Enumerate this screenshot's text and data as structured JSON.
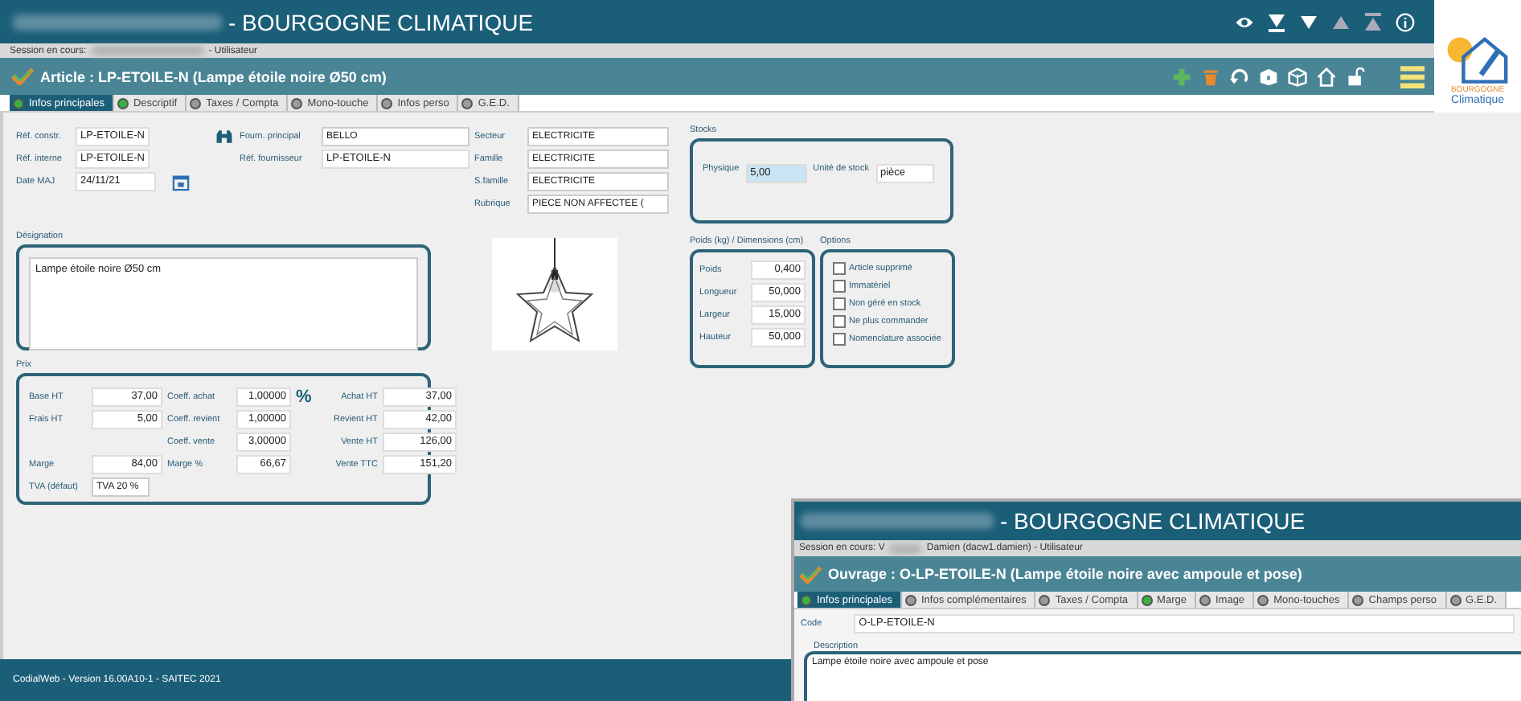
{
  "header": {
    "title": "- BOURGOGNE CLIMATIQUE"
  },
  "session": {
    "prefix": "Session en cours:",
    "suffix": "- Utilisateur"
  },
  "logo": {
    "line1": "BOURGOGNE",
    "line2": "Climatique"
  },
  "article": {
    "title": "Article : LP-ETOILE-N (Lampe étoile noire Ø50 cm)"
  },
  "tabs": [
    {
      "label": "Infos principales",
      "selected": true,
      "color": "#3cb043"
    },
    {
      "label": "Descriptif",
      "selected": false,
      "color": "#3cb043"
    },
    {
      "label": "Taxes / Compta",
      "selected": false,
      "color": "#9a9a9a"
    },
    {
      "label": "Mono-touche",
      "selected": false,
      "color": "#9a9a9a"
    },
    {
      "label": "Infos perso",
      "selected": false,
      "color": "#9a9a9a"
    },
    {
      "label": "G.E.D.",
      "selected": false,
      "color": "#9a9a9a"
    }
  ],
  "identity": [
    {
      "label": "Réf. constr.",
      "value": "LP-ETOILE-N"
    },
    {
      "label": "Réf. interne",
      "value": "LP-ETOILE-N"
    },
    {
      "label": "Date MAJ",
      "value": "24/11/21"
    }
  ],
  "supplier": [
    {
      "label": "Fourn. principal",
      "value": "BELLO",
      "kind": "select"
    },
    {
      "label": "Réf. fournisseur",
      "value": "LP-ETOILE-N",
      "kind": "text"
    }
  ],
  "classification": [
    {
      "label": "Secteur",
      "value": "ELECTRICITE"
    },
    {
      "label": "Famille",
      "value": "ELECTRICITE"
    },
    {
      "label": "S.famille",
      "value": "ELECTRICITE"
    },
    {
      "label": "Rubrique",
      "value": "PIECE NON AFFECTEE ("
    }
  ],
  "designation": {
    "label": "Désignation",
    "value": "Lampe étoile noire Ø50 cm"
  },
  "prices": {
    "label": "Prix",
    "percent_symbol": "%",
    "columns": [
      [
        {
          "label": "Base HT",
          "value": "37,00"
        },
        {
          "label": "Frais HT",
          "value": "5,00"
        },
        null,
        {
          "label": "Marge",
          "value": "84,00"
        }
      ],
      [
        {
          "label": "Coeff. achat",
          "value": "1,00000"
        },
        {
          "label": "Coeff. revient",
          "value": "1,00000"
        },
        {
          "label": "Coeff. vente",
          "value": "3,00000"
        },
        {
          "label": "Marge %",
          "value": "66,67"
        }
      ],
      [
        {
          "label": "Achat HT",
          "value": "37,00"
        },
        {
          "label": "Revient HT",
          "value": "42,00"
        },
        {
          "label": "Vente HT",
          "value": "126,00"
        },
        {
          "label": "Vente TTC",
          "value": "151,20"
        }
      ]
    ],
    "vat_label": "TVA (défaut)",
    "vat": "TVA 20 %"
  },
  "stocks": {
    "label": "Stocks",
    "physical_label": "Physique",
    "physical": "5,00",
    "unit_label": "Unité de stock",
    "unit": "pièce"
  },
  "dimensions": {
    "label": "Poids (kg) / Dimensions (cm)",
    "items": [
      {
        "label": "Poids",
        "value": "0,400"
      },
      {
        "label": "Longueur",
        "value": "50,000"
      },
      {
        "label": "Largeur",
        "value": "15,000"
      },
      {
        "label": "Hauteur",
        "value": "50,000"
      }
    ]
  },
  "options": {
    "label": "Options",
    "items": [
      {
        "label": "Article supprimé",
        "checked": false
      },
      {
        "label": "Immatériel",
        "checked": false
      },
      {
        "label": "Non géré en stock",
        "checked": false
      },
      {
        "label": "Ne plus commander",
        "checked": false
      },
      {
        "label": "Nomenclature associée",
        "checked": false
      }
    ]
  },
  "footer": "CodialWeb - Version 16.00A10-1 - SAITEC 2021",
  "overlay": {
    "title": "- BOURGOGNE CLIMATIQUE",
    "session_prefix": "Session en cours: V",
    "session_suffix": "Damien (dacw1.damien) - Utilisateur",
    "heading": "Ouvrage : O-LP-ETOILE-N (Lampe étoile noire avec ampoule et pose)",
    "tabs": [
      {
        "label": "Infos principales",
        "selected": true,
        "color": "#3cb043"
      },
      {
        "label": "Infos complémentaires",
        "selected": false,
        "color": "#9a9a9a"
      },
      {
        "label": "Taxes / Compta",
        "selected": false,
        "color": "#9a9a9a"
      },
      {
        "label": "Marge",
        "selected": false,
        "color": "#3cb043"
      },
      {
        "label": "Image",
        "selected": false,
        "color": "#9a9a9a"
      },
      {
        "label": "Mono-touches",
        "selected": false,
        "color": "#9a9a9a"
      },
      {
        "label": "Champs perso",
        "selected": false,
        "color": "#9a9a9a"
      },
      {
        "label": "G.E.D.",
        "selected": false,
        "color": "#9a9a9a"
      }
    ],
    "code_label": "Code",
    "code": "O-LP-ETOILE-N",
    "description_label": "Description",
    "description": "Lampe étoile noire avec ampoule et pose"
  }
}
